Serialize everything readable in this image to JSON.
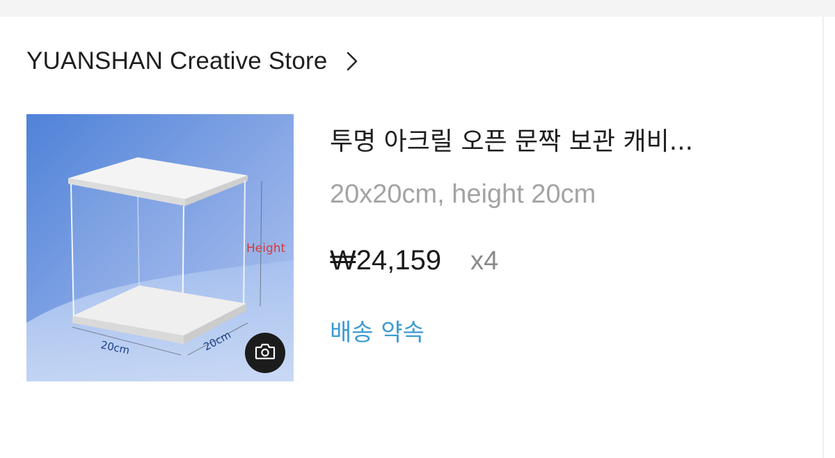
{
  "store": {
    "name": "YUANSHAN Creative Store",
    "chevron_icon": "chevron-right-icon"
  },
  "product": {
    "image_labels": {
      "height": "Height",
      "width": "20cm",
      "depth": "20cm"
    },
    "camera_icon": "camera-icon",
    "title": "투명 아크릴 오픈 문짝 보관 캐비...",
    "variant": "20x20cm, height 20cm",
    "price": "₩24,159",
    "quantity": "x4",
    "delivery_link": "배송 약속"
  },
  "colors": {
    "delivery_link": "#3d9bd1",
    "price": "#1a1a1a",
    "variant": "#a3a3a3",
    "image_background": "#6f97df"
  }
}
